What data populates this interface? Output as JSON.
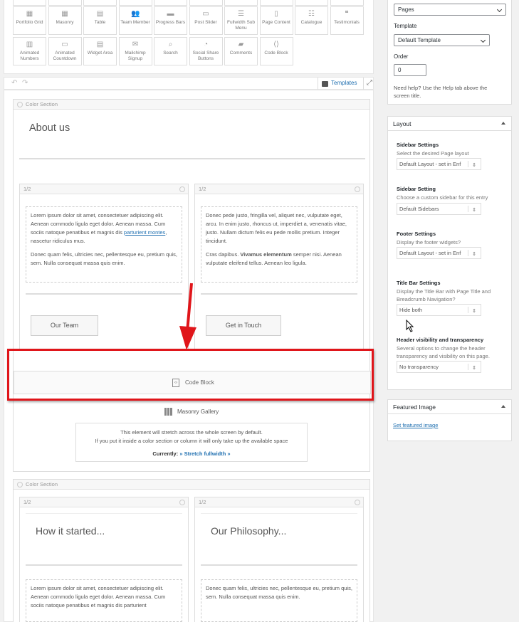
{
  "palette": {
    "row0": [
      "",
      "",
      "",
      "",
      "",
      "",
      "",
      "",
      "",
      ""
    ],
    "row1": [
      {
        "label": "Portfolio Grid",
        "icon": "portfolio-grid-icon",
        "glyph": "▦"
      },
      {
        "label": "Masonry",
        "icon": "masonry-icon",
        "glyph": "▦"
      },
      {
        "label": "Table",
        "icon": "table-icon",
        "glyph": "▤"
      },
      {
        "label": "Team Member",
        "icon": "team-member-icon",
        "glyph": "👥"
      },
      {
        "label": "Progress Bars",
        "icon": "progress-bars-icon",
        "glyph": "▬"
      },
      {
        "label": "Post Slider",
        "icon": "post-slider-icon",
        "glyph": "▭"
      },
      {
        "label": "Fullwidth Sub Menu",
        "icon": "fullwidth-sub-menu-icon",
        "glyph": "☰"
      },
      {
        "label": "Page Content",
        "icon": "page-content-icon",
        "glyph": "▯"
      },
      {
        "label": "Catalogue",
        "icon": "catalogue-icon",
        "glyph": "☷"
      },
      {
        "label": "Testimonials",
        "icon": "testimonials-icon",
        "glyph": "❝"
      }
    ],
    "row2": [
      {
        "label": "Animated Numbers",
        "icon": "animated-numbers-icon",
        "glyph": "▥"
      },
      {
        "label": "Animated Countdown",
        "icon": "animated-countdown-icon",
        "glyph": "▭"
      },
      {
        "label": "Widget Area",
        "icon": "widget-area-icon",
        "glyph": "▤"
      },
      {
        "label": "Mailchimp Signup",
        "icon": "mailchimp-icon",
        "glyph": "✉"
      },
      {
        "label": "Search",
        "icon": "search-icon",
        "glyph": "⌕"
      },
      {
        "label": "Social Share Buttons",
        "icon": "social-share-icon",
        "glyph": "◔"
      },
      {
        "label": "Comments",
        "icon": "comments-icon",
        "glyph": "▰"
      },
      {
        "label": "Code Block",
        "icon": "code-block-icon",
        "glyph": "⟨⟩"
      }
    ]
  },
  "toolbar": {
    "templates_label": "Templates"
  },
  "section1": {
    "head": "Color Section",
    "heading": "About us",
    "col_left": {
      "head": "1/2",
      "p1_a": "Lorem ipsum dolor sit amet, consectetuer adipiscing elit. Aenean commodo ligula eget dolor. Aenean massa. Cum sociis natoque penatibus et magnis dis ",
      "p1_link": "parturient montes",
      "p1_b": ", nascetur ridiculus mus.",
      "p2": "Donec quam felis, ultricies nec, pellentesque eu, pretium quis, sem. Nulla consequat massa quis enim.",
      "button": "Our Team"
    },
    "col_right": {
      "head": "1/2",
      "p1": "Donec pede justo, fringilla vel, aliquet nec, vulputate eget, arcu. In enim justo, rhoncus ut, imperdiet a, venenatis vitae, justo. Nullam dictum felis eu pede mollis pretium. Integer tincidunt.",
      "p2_a": "Cras dapibus. ",
      "p2_bold": "Vivamus elementum",
      "p2_b": " semper nisi. Aenean vulputate eleifend tellus. Aenean leo ligula.",
      "button": "Get in Touch"
    },
    "code_block": "Code Block",
    "masonry_label": "Masonry Gallery",
    "notice_line1": "This element will stretch across the whole screen by default.",
    "notice_line2": "If you put it inside a color section or column it will only take up the available space",
    "currently_label": "Currently:",
    "currently_value": "» Stretch fullwidth »"
  },
  "section2": {
    "head": "Color Section",
    "col_left": {
      "head": "1/2",
      "heading": "How it started...",
      "p1": "Lorem ipsum dolor sit amet, consectetuer adipiscing elit. Aenean commodo ligula eget dolor. Aenean massa. Cum sociis natoque penatibus et magnis dis parturient"
    },
    "col_right": {
      "head": "1/2",
      "heading": "Our Philosophy...",
      "p1": "Donec quam felis, ultricies nec, pellentesque eu, pretium quis, sem. Nulla consequat massa quis enim."
    }
  },
  "sidebar": {
    "parent_value": "Pages",
    "template_label": "Template",
    "template_value": "Default Template",
    "order_label": "Order",
    "order_value": "0",
    "help_text": "Need help? Use the Help tab above the screen title.",
    "layout_title": "Layout",
    "sidebar_settings_label": "Sidebar Settings",
    "sidebar_settings_desc": "Select the desired Page layout",
    "sidebar_settings_value": "Default Layout - set in Enf",
    "sidebar_setting_label": "Sidebar Setting",
    "sidebar_setting_desc": "Choose a custom sidebar for this entry",
    "sidebar_setting_value": "Default Sidebars",
    "footer_label": "Footer Settings",
    "footer_desc": "Display the footer widgets?",
    "footer_value": "Default Layout - set in Enf",
    "titlebar_label": "Title Bar Settings",
    "titlebar_desc": "Display the Title Bar with Page Title and Breadcrumb Navigation?",
    "titlebar_value": "Hide both",
    "header_label": "Header visibility and transparency",
    "header_desc": "Several options to change the header transparency and visibility on this page.",
    "header_value": "No transparency",
    "featured_title": "Featured Image",
    "featured_link": "Set featured image"
  },
  "colors": {
    "highlight": "#e0151a",
    "link": "#2271b1"
  }
}
